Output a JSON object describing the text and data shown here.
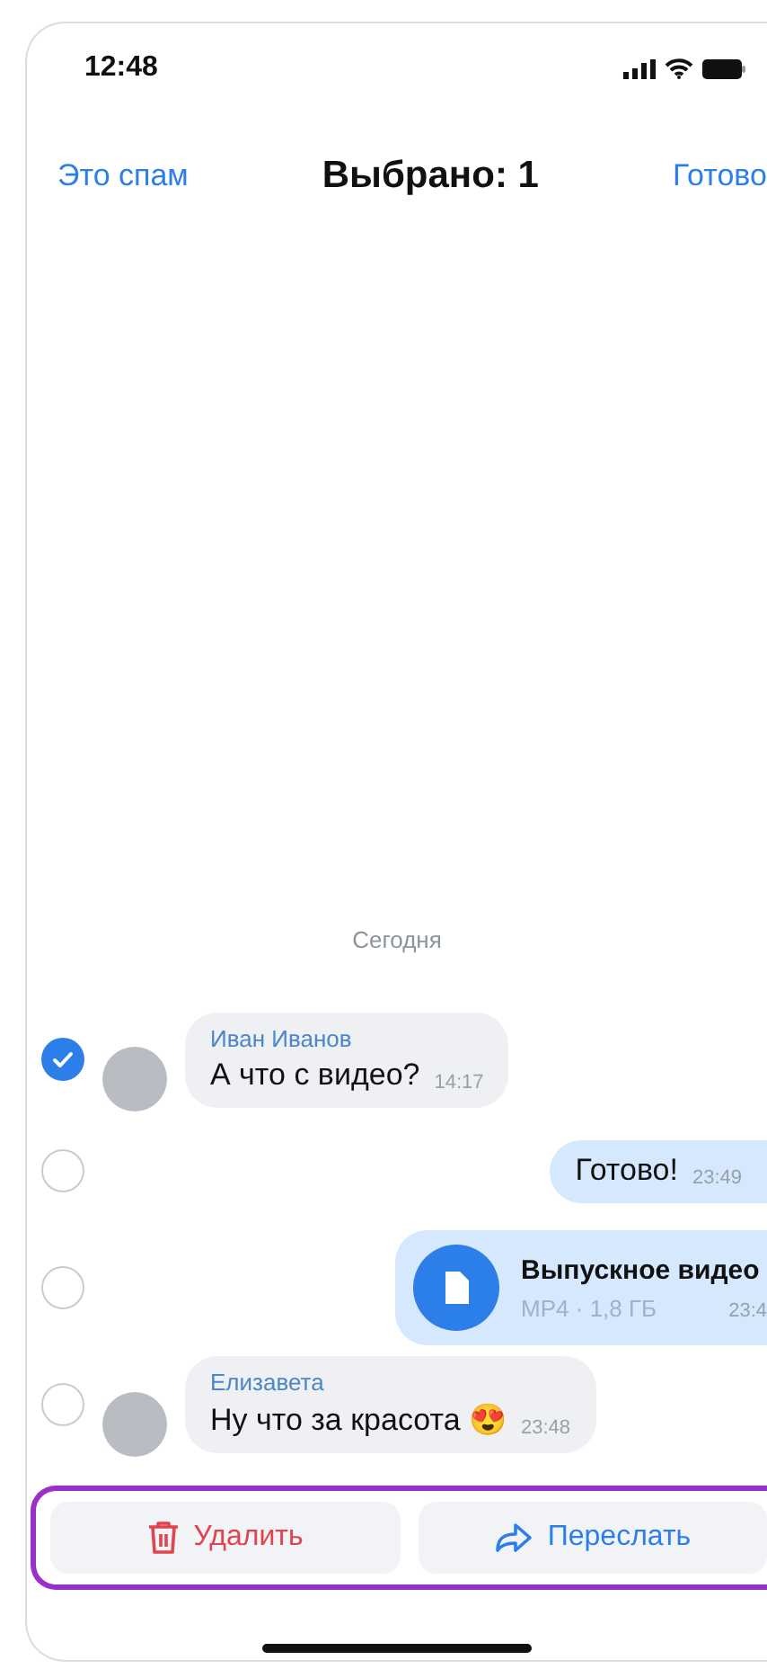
{
  "status_bar": {
    "time": "12:48"
  },
  "nav": {
    "left_action": "Это спам",
    "title": "Выбрано: 1",
    "right_action": "Готово"
  },
  "date_separator": "Сегодня",
  "messages": [
    {
      "kind": "incoming",
      "selected": true,
      "sender": "Иван Иванов",
      "text": "А что с видео?",
      "time": "14:17"
    },
    {
      "kind": "outgoing",
      "selected": false,
      "text": "Готово!",
      "time": "23:49"
    },
    {
      "kind": "file",
      "selected": false,
      "file_name": "Выпускное видео",
      "file_meta": "MP4 · 1,8 ГБ",
      "time": "23:4"
    },
    {
      "kind": "incoming",
      "selected": false,
      "sender": "Елизавета",
      "text": "Ну что за красота 😍",
      "time": "23:48"
    }
  ],
  "actions": [
    {
      "kind": "delete",
      "label": "Удалить"
    },
    {
      "kind": "forward",
      "label": "Переслать"
    }
  ]
}
